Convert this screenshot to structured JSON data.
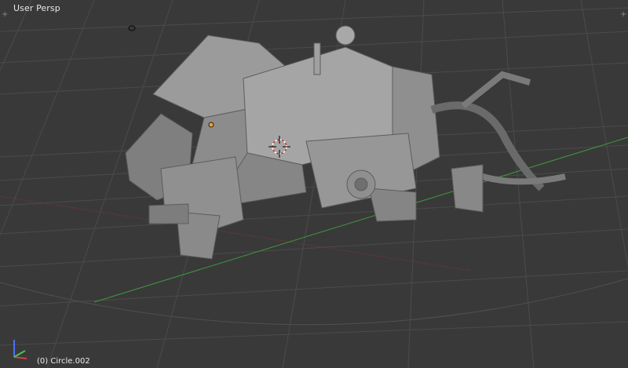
{
  "viewport": {
    "view_label": "User Persp",
    "object_label": "(0) Circle.002",
    "background": "#393939",
    "grid_color": "#4a4a4a",
    "x_axis_color": "#8a3a3a",
    "y_axis_color": "#3f9a3f",
    "mesh_color": "#9a9a9a",
    "selection_origin_color": "#f0a030"
  },
  "gizmo": {
    "x_color": "#d04040",
    "y_color": "#50c050",
    "z_color": "#4a70ff"
  },
  "icons": {
    "corner_left": "plus-corner-icon",
    "corner_right": "plus-corner-icon",
    "cursor": "3d-cursor-icon",
    "light": "lamp-icon"
  }
}
